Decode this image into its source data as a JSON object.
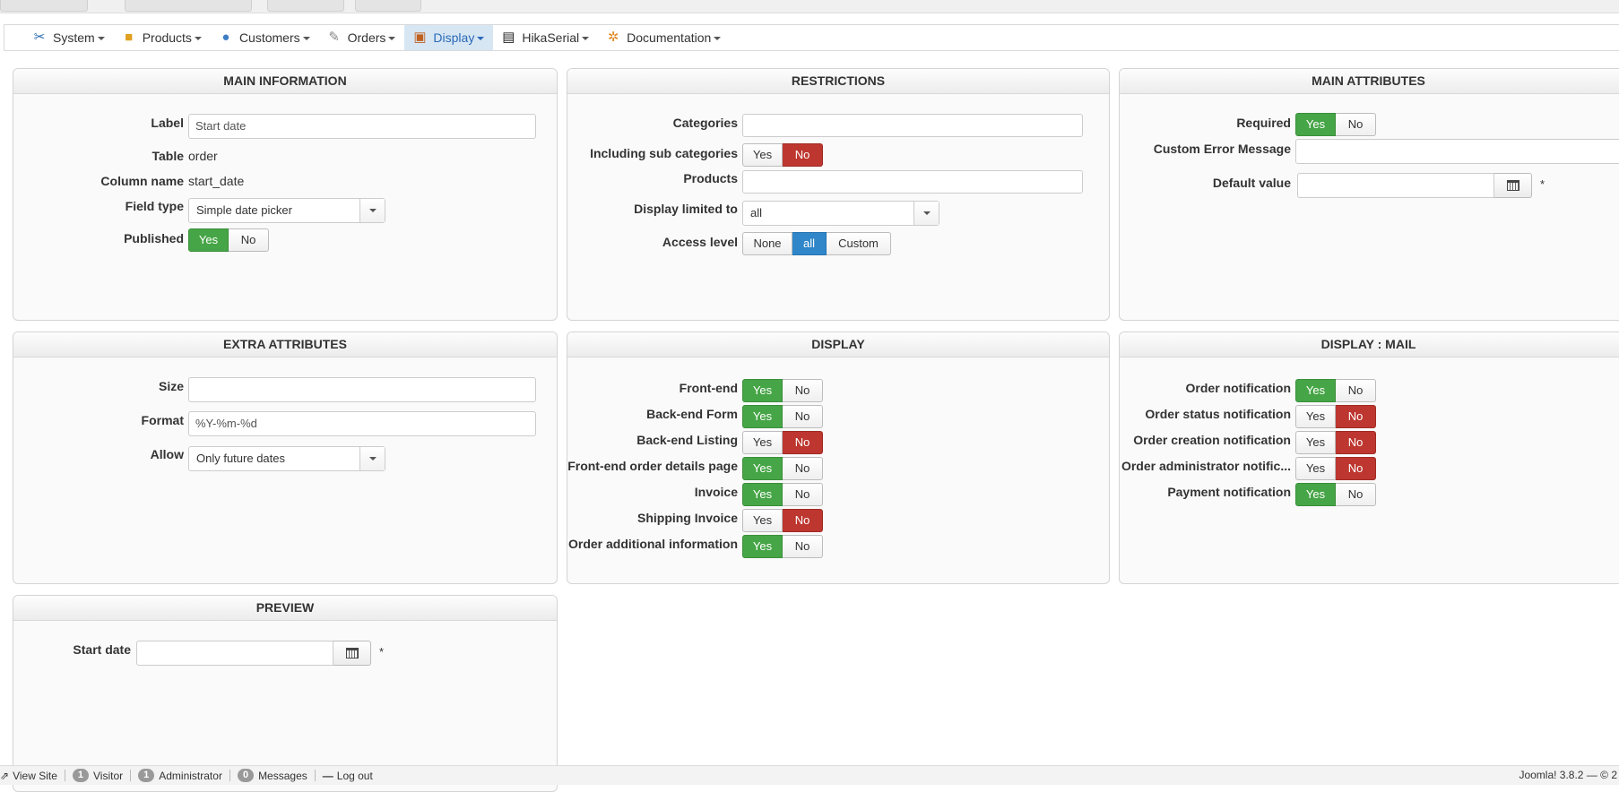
{
  "menu": [
    {
      "label": "System",
      "icon": "tools-icon"
    },
    {
      "label": "Products",
      "icon": "box-icon"
    },
    {
      "label": "Customers",
      "icon": "users-icon"
    },
    {
      "label": "Orders",
      "icon": "orders-icon"
    },
    {
      "label": "Display",
      "icon": "display-icon"
    },
    {
      "label": "HikaSerial",
      "icon": "serial-icon"
    },
    {
      "label": "Documentation",
      "icon": "lifebuoy-icon"
    }
  ],
  "main_info": {
    "title": "MAIN INFORMATION",
    "label_label": "Label",
    "label_value": "Start date",
    "table_label": "Table",
    "table_value": "order",
    "column_label": "Column name",
    "column_value": "start_date",
    "fieldtype_label": "Field type",
    "fieldtype_value": "Simple date picker",
    "published_label": "Published"
  },
  "restrictions": {
    "title": "RESTRICTIONS",
    "categories_label": "Categories",
    "subcat_label": "Including sub categories",
    "products_label": "Products",
    "limited_label": "Display limited to",
    "limited_value": "all",
    "access_label": "Access level",
    "access_none": "None",
    "access_all": "all",
    "access_custom": "Custom"
  },
  "main_attr": {
    "title": "MAIN ATTRIBUTES",
    "required_label": "Required",
    "error_label": "Custom Error Message",
    "default_label": "Default value",
    "star": "*"
  },
  "extra_attr": {
    "title": "EXTRA ATTRIBUTES",
    "size_label": "Size",
    "size_value": "",
    "format_label": "Format",
    "format_value": "%Y-%m-%d",
    "allow_label": "Allow",
    "allow_value": "Only future dates"
  },
  "display": {
    "title": "DISPLAY",
    "rows": [
      {
        "label": "Front-end",
        "value": "yes"
      },
      {
        "label": "Back-end Form",
        "value": "yes"
      },
      {
        "label": "Back-end Listing",
        "value": "no"
      },
      {
        "label": "Front-end order details page",
        "value": "yes"
      },
      {
        "label": "Invoice",
        "value": "yes"
      },
      {
        "label": "Shipping Invoice",
        "value": "no"
      },
      {
        "label": "Order additional information",
        "value": "yes"
      }
    ]
  },
  "display_mail": {
    "title": "DISPLAY : MAIL",
    "rows": [
      {
        "label": "Order notification",
        "value": "yes"
      },
      {
        "label": "Order status notification",
        "value": "no"
      },
      {
        "label": "Order creation notification",
        "value": "no"
      },
      {
        "label": "Order administrator notific...",
        "value": "no"
      },
      {
        "label": "Payment notification",
        "value": "yes"
      }
    ]
  },
  "preview": {
    "title": "PREVIEW",
    "field_label": "Start date",
    "star": "*"
  },
  "yes": "Yes",
  "no": "No",
  "statusbar": {
    "view_site": "View Site",
    "visitor_count": "1",
    "visitor_label": "Visitor",
    "admin_count": "1",
    "admin_label": "Administrator",
    "messages_count": "0",
    "messages_label": "Messages",
    "logout": "Log out",
    "version": "Joomla! 3.8.2 — © 2"
  },
  "colors": {
    "yes_active": "#46a546",
    "no_active": "#bd362f",
    "selected": "#2f86c9",
    "menu_active_bg": "#d7e6f3"
  }
}
